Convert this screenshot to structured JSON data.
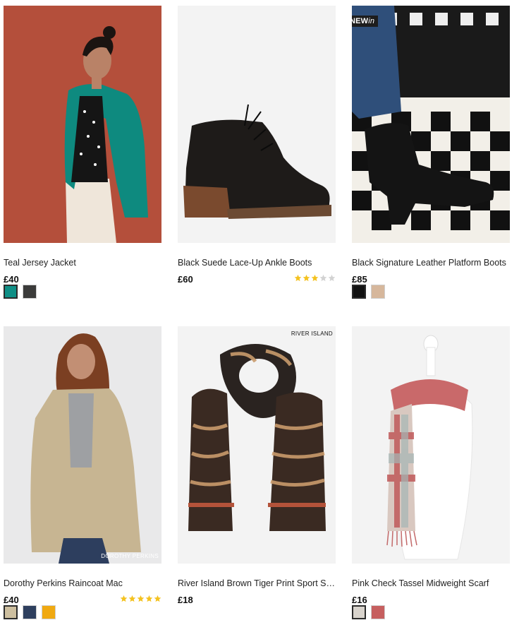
{
  "products": [
    {
      "name": "Teal Jersey Jacket",
      "price": "£40",
      "swatches": [
        "#0f8f86",
        "#3b3b3a"
      ],
      "selected_swatch": 0
    },
    {
      "name": "Black Suede Lace-Up Ankle Boots",
      "price": "£60",
      "rating": 3,
      "rating_max": 5
    },
    {
      "name": "Black Signature Leather Platform Boots",
      "price": "£85",
      "badge": {
        "main": "NEW",
        "italic": "in"
      },
      "swatches": [
        "#121212",
        "#d6b79c"
      ],
      "selected_swatch": 0
    },
    {
      "name": "Dorothy Perkins Raincoat Mac",
      "price": "£40",
      "brand_tag": "DOROTHY PERKINS",
      "rating": 5,
      "rating_max": 5,
      "swatches": [
        "#cdbf9f",
        "#2e3f5e",
        "#f0a911"
      ],
      "selected_swatch": 0
    },
    {
      "name": "River Island Brown Tiger Print Sport St…",
      "price": "£18",
      "brand_tag": "RIVER ISLAND"
    },
    {
      "name": "Pink Check Tassel Midweight Scarf",
      "price": "£16",
      "swatches": [
        "#d8d3cc",
        "#c65f5f"
      ],
      "selected_swatch": 0
    }
  ],
  "colors": {
    "star_on": "#f4c21f",
    "star_off": "#d2d2d2"
  }
}
